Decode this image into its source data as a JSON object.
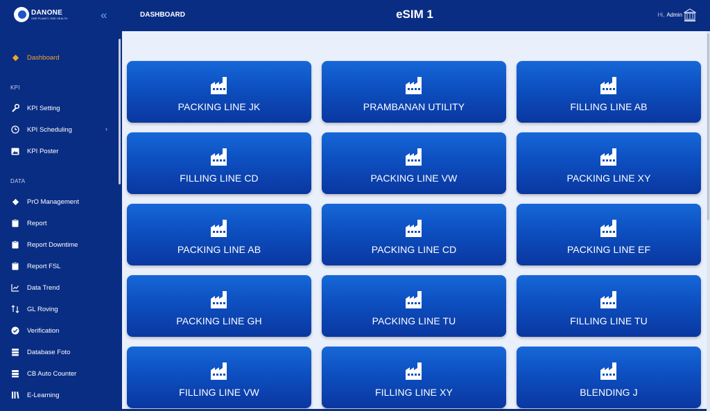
{
  "brand": {
    "name": "DANONE",
    "tagline": "ONE PLANET. ONE HEALTH"
  },
  "header": {
    "breadcrumb": "DASHBOARD",
    "title": "eSIM 1",
    "greeting": "Hi,",
    "user": "Admin"
  },
  "sidebar": {
    "dashboard": "Dashboard",
    "section_kpi": "KPI",
    "kpi_setting": "KPI Setting",
    "kpi_scheduling": "KPI Scheduling",
    "kpi_poster": "KPI Poster",
    "section_data": "DATA",
    "pro_management": "PrO Management",
    "report": "Report",
    "report_downtime": "Report Downtime",
    "report_fsl": "Report FSL",
    "data_trend": "Data Trend",
    "gl_roving": "GL Roving",
    "verification": "Verification",
    "database_foto": "Database Foto",
    "cb_auto_counter": "CB Auto Counter",
    "e_learning": "E-Learning"
  },
  "cards": [
    "PACKING LINE JK",
    "PRAMBANAN UTILITY",
    "FILLING LINE AB",
    "FILLING LINE CD",
    "PACKING LINE VW",
    "PACKING LINE XY",
    "PACKING LINE AB",
    "PACKING LINE CD",
    "PACKING LINE EF",
    "PACKING LINE GH",
    "PACKING LINE TU",
    "FILLING LINE TU",
    "FILLING LINE VW",
    "FILLING LINE XY",
    "BLENDING J"
  ],
  "colors": {
    "accent": "#f5a623",
    "sidebar": "#0a2d84",
    "card": "#0d4fc0",
    "content": "#eaf0fb"
  }
}
